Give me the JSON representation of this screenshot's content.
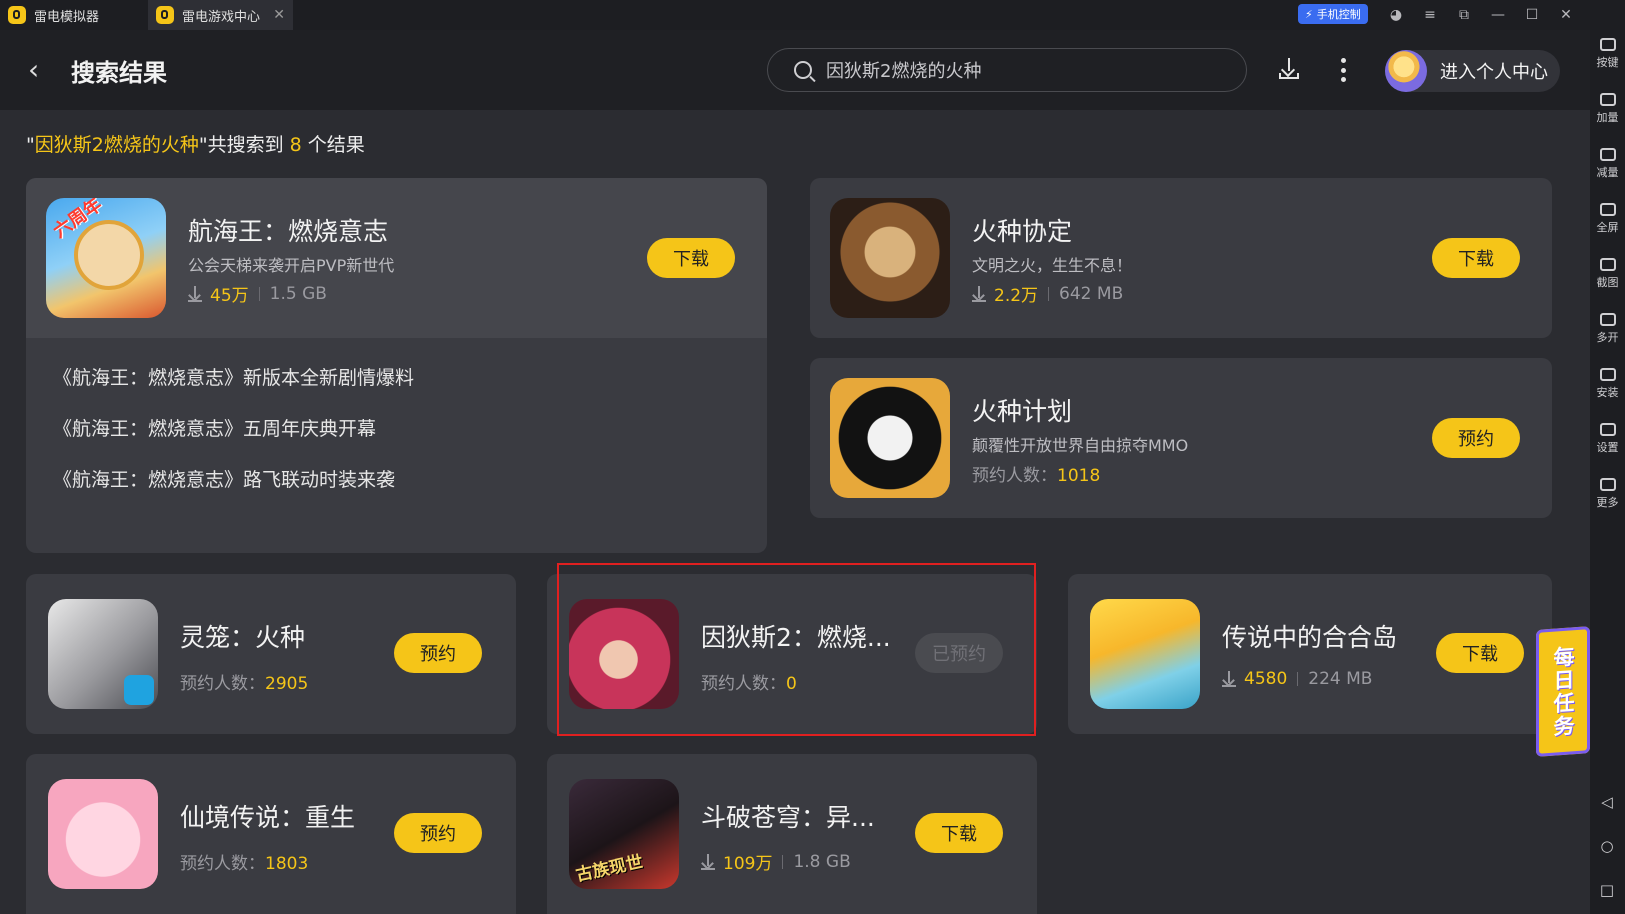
{
  "titlebar": {
    "tabs": [
      {
        "label": "雷电模拟器"
      },
      {
        "label": "雷电游戏中心"
      }
    ],
    "phone_control": "手机控制"
  },
  "header": {
    "title": "搜索结果",
    "search_value": "因狄斯2燃烧的火种",
    "user_center": "进入个人中心"
  },
  "summary": {
    "prefix": "\"",
    "query": "因狄斯2燃烧的火种",
    "middle": "\"共搜索到 ",
    "count": "8",
    "suffix": " 个结果"
  },
  "featured": {
    "name": "航海王：燃烧意志",
    "desc": "公会天梯来袭开启PVP新世代",
    "downloads": "45万",
    "size": "1.5 GB",
    "button": "下载",
    "icon_label": "六周年",
    "news": [
      "《航海王：燃烧意志》新版本全新剧情爆料",
      "《航海王：燃烧意志》五周年庆典开幕",
      "《航海王：燃烧意志》路飞联动时装来袭"
    ]
  },
  "right_cards": [
    {
      "name": "火种协定",
      "desc": "文明之火，生生不息！",
      "downloads": "2.2万",
      "size": "642 MB",
      "button": "下载"
    },
    {
      "name": "火种计划",
      "desc": "颠覆性开放世界自由掠夺MMO",
      "reserve_label": "预约人数：",
      "reserve_count": "1018",
      "button": "预约"
    }
  ],
  "grid": [
    {
      "name": "灵笼：火种",
      "reserve_label": "预约人数：",
      "reserve_count": "2905",
      "button": "预约"
    },
    {
      "name": "因狄斯2：燃烧...",
      "reserve_label": "预约人数：",
      "reserve_count": "0",
      "button": "已预约"
    },
    {
      "name": "传说中的合合岛",
      "downloads": "4580",
      "size": "224 MB",
      "button": "下载"
    },
    {
      "name": "仙境传说：重生",
      "reserve_label": "预约人数：",
      "reserve_count": "1803",
      "button": "预约"
    },
    {
      "name": "斗破苍穹：异...",
      "downloads": "109万",
      "size": "1.8 GB",
      "button": "下载",
      "icon_label": "古族现世"
    }
  ],
  "sidebar": [
    "按键",
    "加量",
    "减量",
    "全屏",
    "截图",
    "多开",
    "安装",
    "设置",
    "更多"
  ],
  "daily_task": "每日任务",
  "colors": {
    "accent": "#f5c518",
    "background": "#2b2c31",
    "card": "#3a3b41",
    "highlight": "#e02020"
  }
}
